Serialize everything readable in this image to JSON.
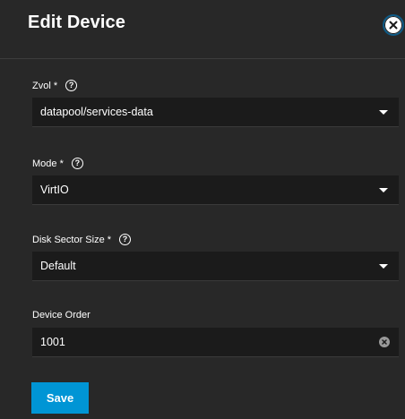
{
  "dialog": {
    "title": "Edit Device",
    "close_icon": "close-circle-icon"
  },
  "fields": {
    "zvol": {
      "label": "Zvol *",
      "value": "datapool/services-data",
      "help_icon": "question-circle-icon"
    },
    "mode": {
      "label": "Mode *",
      "value": "VirtIO",
      "help_icon": "question-circle-icon"
    },
    "disk_sector_size": {
      "label": "Disk Sector Size *",
      "value": "Default",
      "help_icon": "question-circle-icon"
    },
    "device_order": {
      "label": "Device Order",
      "value": "1001",
      "clear_icon": "clear-circle-icon"
    }
  },
  "actions": {
    "save_label": "Save"
  },
  "colors": {
    "background": "#282828",
    "field_background": "#1b1b1b",
    "accent": "#0095d5"
  }
}
